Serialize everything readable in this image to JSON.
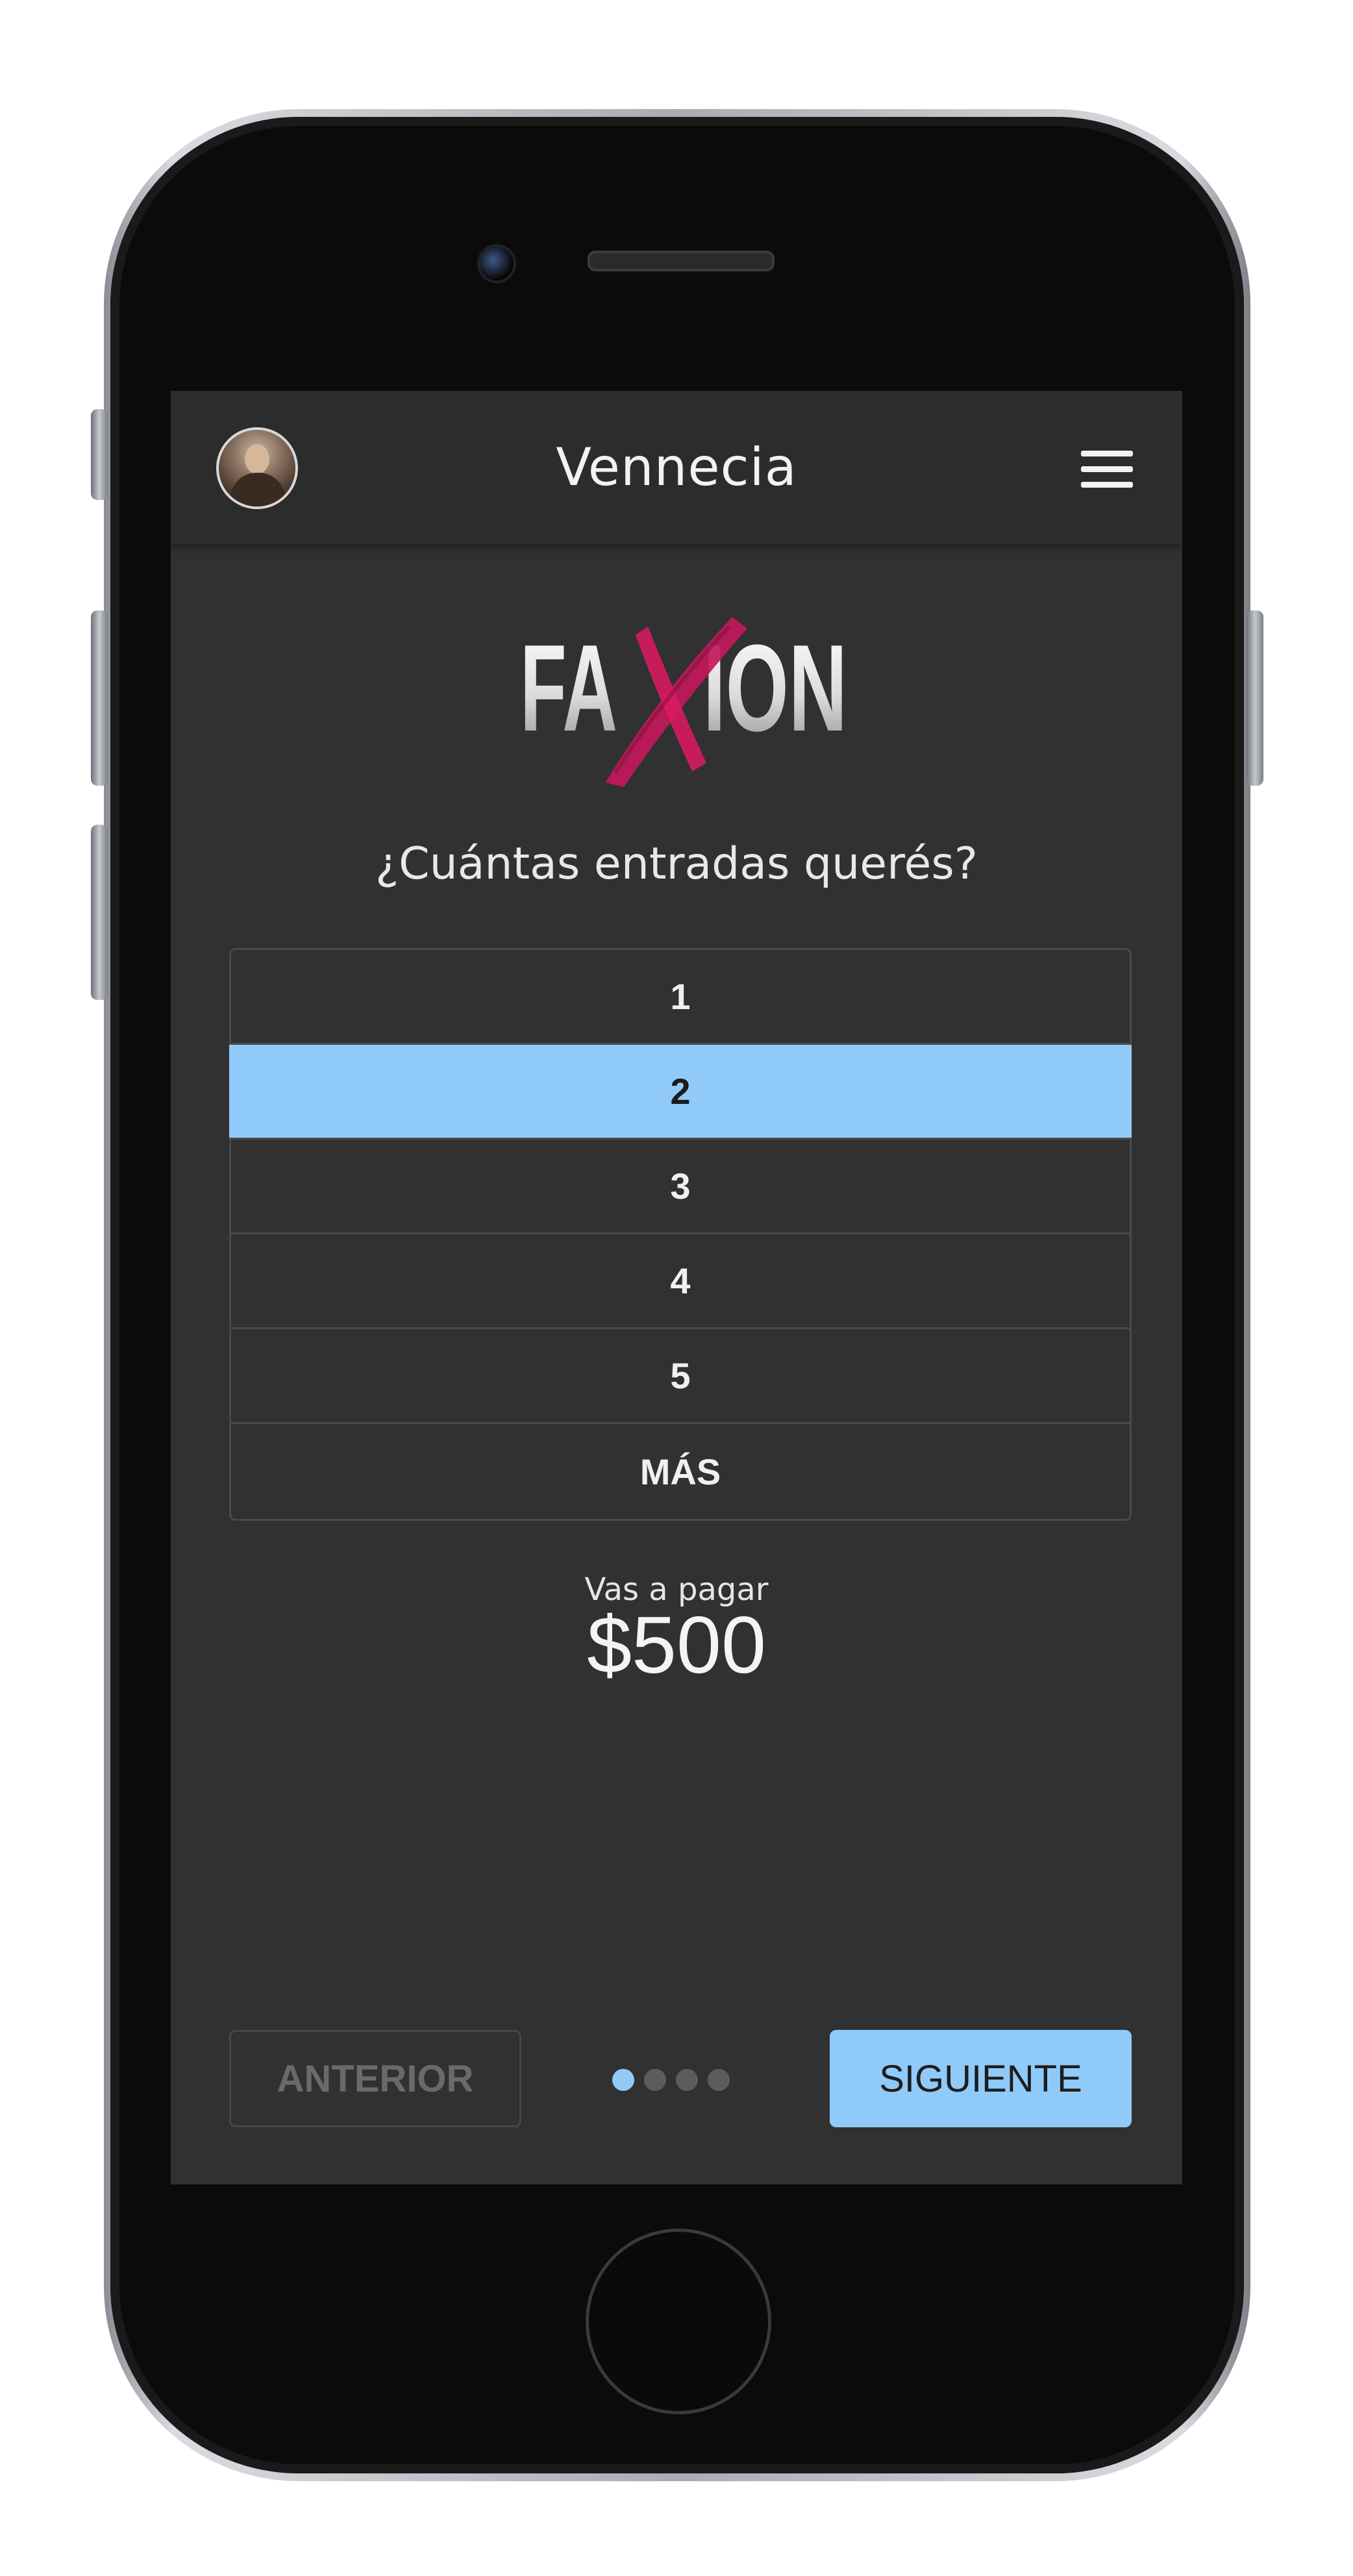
{
  "header": {
    "title": "Vennecia",
    "avatar_icon": "user-avatar",
    "menu_icon": "hamburger-menu-icon"
  },
  "logo": {
    "text_left": "FA",
    "text_x": "X",
    "text_right": "ION"
  },
  "question": "¿Cuántas entradas querés?",
  "options": [
    {
      "label": "1",
      "selected": false
    },
    {
      "label": "2",
      "selected": true
    },
    {
      "label": "3",
      "selected": false
    },
    {
      "label": "4",
      "selected": false
    },
    {
      "label": "5",
      "selected": false
    },
    {
      "label": "MÁS",
      "selected": false
    }
  ],
  "payment": {
    "label": "Vas a pagar",
    "amount": "$500"
  },
  "navigation": {
    "prev_label": "ANTERIOR",
    "next_label": "SIGUIENTE",
    "steps_total": 4,
    "current_step": 1
  },
  "colors": {
    "accent": "#90caf9",
    "screen_bg": "#313131",
    "logo_x": "#c2185b"
  }
}
